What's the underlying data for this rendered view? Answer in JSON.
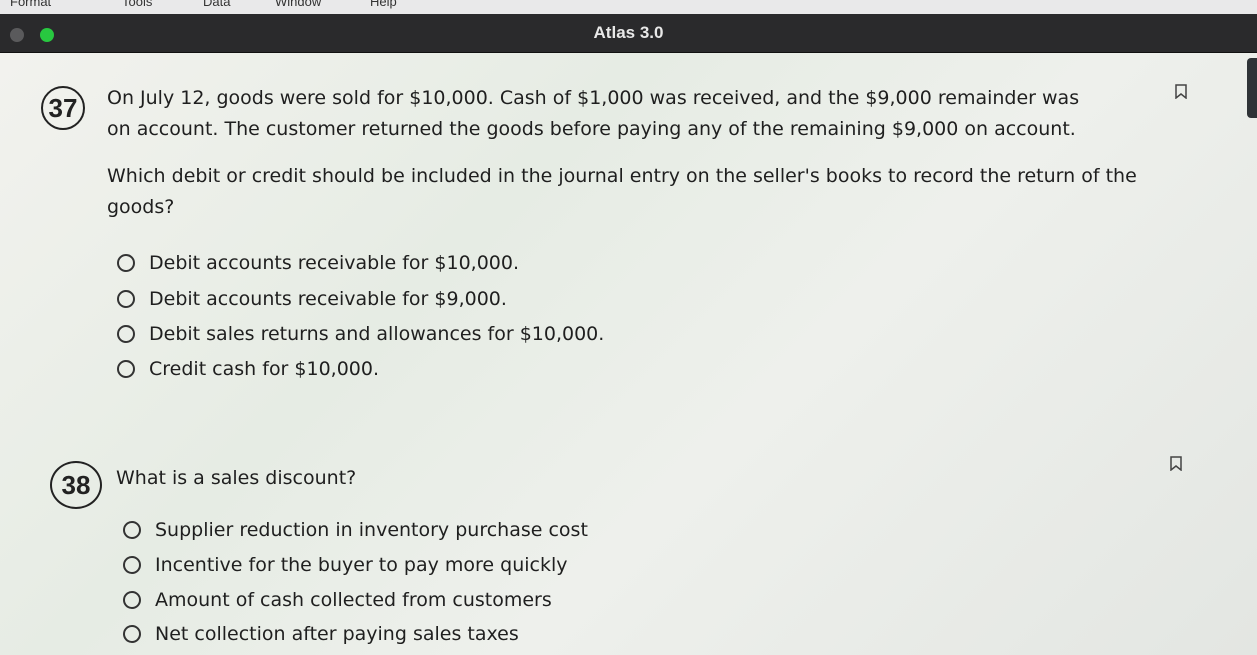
{
  "menubar": [
    "Format",
    "Tools",
    "Data",
    "Window",
    "Help"
  ],
  "window": {
    "title": "Atlas 3.0"
  },
  "questions": [
    {
      "number": "37",
      "stem": "On July 12, goods were sold for $10,000. Cash of $1,000 was received, and the $9,000 remainder was on account. The customer returned the goods before paying any of the remaining $9,000 on account.",
      "prompt": "Which debit or credit should be included in the journal entry on the seller's books to record the return of the goods?",
      "options": [
        "Debit accounts receivable for $10,000.",
        "Debit accounts receivable for $9,000.",
        "Debit sales returns and allowances for $10,000.",
        "Credit cash for $10,000."
      ]
    },
    {
      "number": "38",
      "stem": "What is a sales discount?",
      "options": [
        "Supplier reduction in inventory purchase cost",
        "Incentive for the buyer to pay more quickly",
        "Amount of cash collected from customers",
        "Net collection after paying sales taxes"
      ]
    }
  ]
}
